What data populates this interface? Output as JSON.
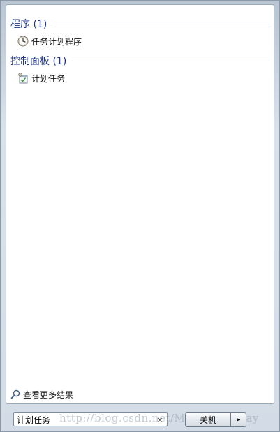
{
  "results": {
    "groups": [
      {
        "title": "程序 (1)",
        "items": [
          {
            "label": "任务计划程序",
            "icon": "clock-icon"
          }
        ]
      },
      {
        "title": "控制面板 (1)",
        "items": [
          {
            "label": "计划任务",
            "icon": "scheduled-tasks-icon"
          }
        ]
      }
    ],
    "see_more_label": "查看更多结果",
    "see_more_icon": "search-magnifier-icon"
  },
  "search": {
    "value": "计划任务",
    "clear_glyph": "×"
  },
  "shutdown": {
    "label": "关机",
    "arrow_glyph": "▸"
  },
  "watermark": {
    "text": "http://blog.csdn.net/MarkNightWay"
  },
  "colors": {
    "group_title": "#1e3287",
    "panel_background": "#ffffff",
    "frame_background": "#d3dce6"
  }
}
